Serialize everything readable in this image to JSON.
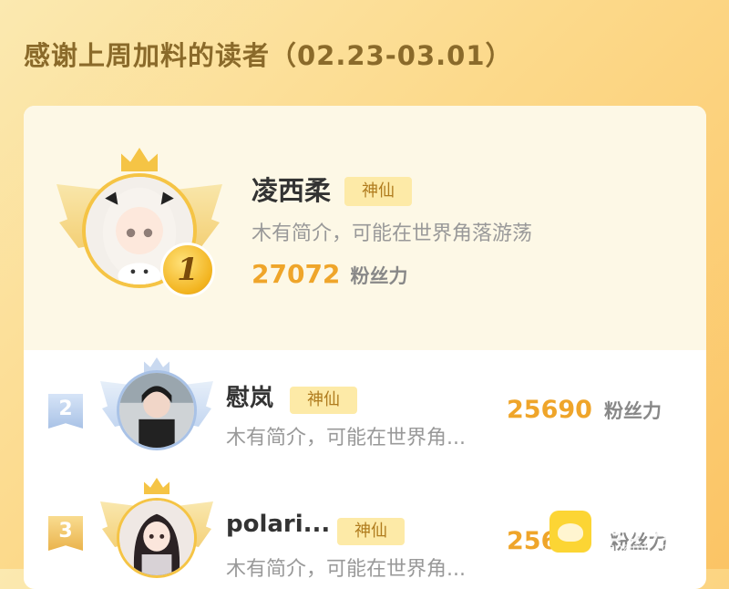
{
  "header": {
    "title": "感谢上周加料的读者（02.23-03.01）"
  },
  "readers": [
    {
      "rank": "1",
      "name": "凌西柔",
      "badge": "神仙",
      "bio": "木有简介，可能在世界角落游荡",
      "score": "27072",
      "score_unit": "粉丝力"
    },
    {
      "rank": "2",
      "name": "慰岚",
      "badge": "神仙",
      "bio": "木有简介，可能在世界角...",
      "score": "25690",
      "score_unit": "粉丝力"
    },
    {
      "rank": "3",
      "name": "polari...",
      "badge": "神仙",
      "bio": "木有简介，可能在世界角...",
      "score": "256",
      "score_unit": "粉丝力"
    }
  ],
  "watermark": {
    "text": "包子漫畫",
    "sub": "baozimh.com"
  },
  "colors": {
    "accent": "#efa52a",
    "badge_bg": "#fdeaa7",
    "gold": "#f5c445",
    "silver": "#b9cfee"
  }
}
